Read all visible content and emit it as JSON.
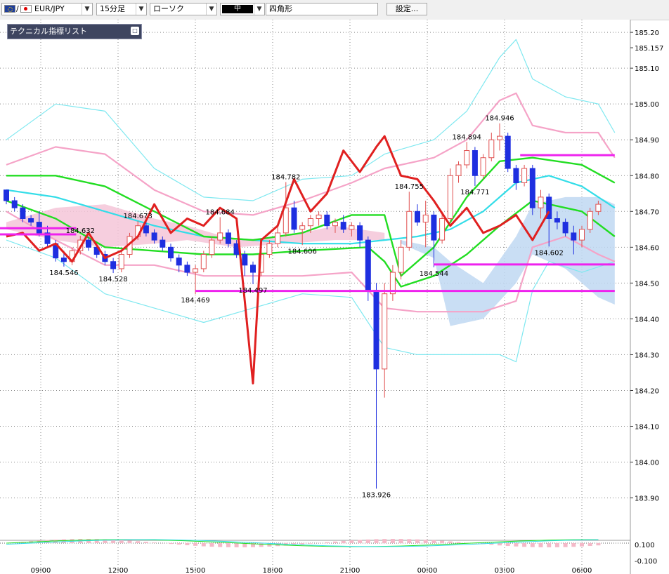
{
  "toolbar": {
    "symbol": "EUR/JPY",
    "symbol_sep": "/",
    "timeframe": "15分足",
    "chart_type": "ローソク",
    "color_label": "中",
    "shape": "四角形",
    "settings": "設定..."
  },
  "indicator_panel": {
    "label": "テクニカル指標リスト",
    "button": "□"
  },
  "icons": {
    "flag_eu": "eu-flag-icon",
    "flag_jp": "jp-flag-icon",
    "dropdown": "chevron-down-icon",
    "panel": "restore-icon"
  },
  "colors": {
    "bull_body": "#ffffff",
    "bull_line": "#e05050",
    "bear_body": "#1e2fe0",
    "bear_line": "#1e2fe0",
    "sma": "#22dd22",
    "mid": "#33dde8",
    "bb_outer": "#7ee8f0",
    "bb_inner": "#f5a3c7",
    "rsi": "#e02020",
    "level": "#ee22ee",
    "cloud_a": "#f5c6d8",
    "cloud_b": "#bfd8f2",
    "grid": "#888888"
  },
  "chart_data": {
    "type": "candlestick",
    "symbol": "EUR/JPY",
    "timeframe": "15分足",
    "ylim": [
      183.86,
      185.21
    ],
    "y_ticks": [
      "185.20",
      "185.157",
      "185.10",
      "185.00",
      "184.90",
      "184.80",
      "184.70",
      "184.60",
      "184.50",
      "184.40",
      "184.30",
      "184.20",
      "184.10",
      "184.00",
      "183.90"
    ],
    "x_ticks": [
      "09:00",
      "12:00",
      "15:00",
      "18:00",
      "21:00",
      "00:00",
      "03:00",
      "06:00"
    ],
    "oscillator_ticks": [
      "0.100",
      "-0.100"
    ],
    "candles": [
      [
        184.76,
        184.76,
        184.72,
        184.73
      ],
      [
        184.73,
        184.74,
        184.7,
        184.71
      ],
      [
        184.71,
        184.72,
        184.67,
        184.68
      ],
      [
        184.68,
        184.69,
        184.66,
        184.67
      ],
      [
        184.67,
        184.7,
        184.63,
        184.64
      ],
      [
        184.64,
        184.66,
        184.6,
        184.61
      ],
      [
        184.61,
        184.62,
        184.56,
        184.57
      ],
      [
        184.57,
        184.59,
        184.546,
        184.56
      ],
      [
        184.56,
        184.6,
        184.55,
        184.59
      ],
      [
        184.59,
        184.632,
        184.58,
        184.62
      ],
      [
        184.62,
        184.63,
        184.59,
        184.6
      ],
      [
        184.6,
        184.61,
        184.57,
        184.58
      ],
      [
        184.58,
        184.59,
        184.55,
        184.56
      ],
      [
        184.56,
        184.57,
        184.528,
        184.54
      ],
      [
        184.54,
        184.59,
        184.53,
        184.58
      ],
      [
        184.58,
        184.64,
        184.57,
        184.63
      ],
      [
        184.63,
        184.673,
        184.62,
        184.66
      ],
      [
        184.66,
        184.67,
        184.63,
        184.64
      ],
      [
        184.64,
        184.65,
        184.61,
        184.62
      ],
      [
        184.62,
        184.63,
        184.59,
        184.6
      ],
      [
        184.6,
        184.61,
        184.56,
        184.57
      ],
      [
        184.57,
        184.58,
        184.53,
        184.55
      ],
      [
        184.55,
        184.56,
        184.52,
        184.53
      ],
      [
        184.53,
        184.55,
        184.469,
        184.54
      ],
      [
        184.54,
        184.59,
        184.53,
        184.58
      ],
      [
        184.58,
        184.63,
        184.57,
        184.62
      ],
      [
        184.62,
        184.684,
        184.61,
        184.64
      ],
      [
        184.64,
        184.65,
        184.6,
        184.61
      ],
      [
        184.61,
        184.62,
        184.57,
        184.58
      ],
      [
        184.58,
        184.59,
        184.52,
        184.55
      ],
      [
        184.55,
        184.56,
        184.497,
        184.53
      ],
      [
        184.53,
        184.59,
        184.52,
        184.58
      ],
      [
        184.58,
        184.62,
        184.57,
        184.61
      ],
      [
        184.61,
        184.66,
        184.6,
        184.64
      ],
      [
        184.64,
        184.782,
        184.63,
        184.71
      ],
      [
        184.71,
        184.73,
        184.64,
        184.65
      ],
      [
        184.65,
        184.67,
        184.606,
        184.66
      ],
      [
        184.66,
        184.69,
        184.64,
        184.68
      ],
      [
        184.68,
        184.7,
        184.66,
        184.69
      ],
      [
        184.69,
        184.7,
        184.65,
        184.66
      ],
      [
        184.66,
        184.68,
        184.64,
        184.67
      ],
      [
        184.67,
        184.69,
        184.64,
        184.65
      ],
      [
        184.65,
        184.67,
        184.63,
        184.66
      ],
      [
        184.66,
        184.67,
        184.6,
        184.62
      ],
      [
        184.62,
        184.63,
        184.45,
        184.48
      ],
      [
        184.48,
        184.5,
        183.926,
        184.26
      ],
      [
        184.26,
        184.5,
        184.18,
        184.47
      ],
      [
        184.47,
        184.55,
        184.45,
        184.53
      ],
      [
        184.53,
        184.62,
        184.51,
        184.6
      ],
      [
        184.6,
        184.755,
        184.59,
        184.7
      ],
      [
        184.7,
        184.72,
        184.66,
        184.67
      ],
      [
        184.67,
        184.73,
        184.6,
        184.69
      ],
      [
        184.69,
        184.7,
        184.544,
        184.62
      ],
      [
        184.62,
        184.7,
        184.61,
        184.68
      ],
      [
        184.68,
        184.82,
        184.67,
        184.8
      ],
      [
        184.8,
        184.84,
        184.78,
        184.83
      ],
      [
        184.83,
        184.894,
        184.82,
        184.87
      ],
      [
        184.87,
        184.88,
        184.771,
        184.8
      ],
      [
        184.8,
        184.86,
        184.79,
        184.85
      ],
      [
        184.85,
        184.92,
        184.84,
        184.9
      ],
      [
        184.9,
        184.946,
        184.87,
        184.91
      ],
      [
        184.91,
        184.92,
        184.81,
        184.82
      ],
      [
        184.82,
        184.83,
        184.76,
        184.78
      ],
      [
        184.78,
        184.83,
        184.77,
        184.82
      ],
      [
        184.82,
        184.83,
        184.69,
        184.71
      ],
      [
        184.71,
        184.76,
        184.68,
        184.74
      ],
      [
        184.74,
        184.75,
        184.602,
        184.68
      ],
      [
        184.68,
        184.7,
        184.65,
        184.67
      ],
      [
        184.67,
        184.68,
        184.63,
        184.64
      ],
      [
        184.64,
        184.66,
        184.58,
        184.62
      ],
      [
        184.62,
        184.66,
        184.6,
        184.65
      ],
      [
        184.65,
        184.71,
        184.64,
        184.7
      ],
      [
        184.7,
        184.73,
        184.69,
        184.72
      ]
    ],
    "price_labels": [
      {
        "text": "184.546",
        "price": 184.546,
        "candle": 7,
        "pos": "below"
      },
      {
        "text": "184.632",
        "price": 184.632,
        "candle": 9,
        "pos": "above"
      },
      {
        "text": "184.528",
        "price": 184.528,
        "candle": 13,
        "pos": "below"
      },
      {
        "text": "184.673",
        "price": 184.673,
        "candle": 16,
        "pos": "above"
      },
      {
        "text": "184.469",
        "price": 184.469,
        "candle": 23,
        "pos": "below"
      },
      {
        "text": "184.684",
        "price": 184.684,
        "candle": 26,
        "pos": "above"
      },
      {
        "text": "184.497",
        "price": 184.497,
        "candle": 30,
        "pos": "below"
      },
      {
        "text": "184.782",
        "price": 184.782,
        "candle": 34,
        "pos": "above"
      },
      {
        "text": "184.606",
        "price": 184.606,
        "candle": 36,
        "pos": "below"
      },
      {
        "text": "183.926",
        "price": 183.926,
        "candle": 45,
        "pos": "below"
      },
      {
        "text": "184.755",
        "price": 184.755,
        "candle": 49,
        "pos": "above"
      },
      {
        "text": "184.544",
        "price": 184.544,
        "candle": 52,
        "pos": "below"
      },
      {
        "text": "184.894",
        "price": 184.894,
        "candle": 56,
        "pos": "above"
      },
      {
        "text": "184.771",
        "price": 184.771,
        "candle": 57,
        "pos": "below"
      },
      {
        "text": "184.946",
        "price": 184.946,
        "candle": 60,
        "pos": "above"
      },
      {
        "text": "184.602",
        "price": 184.602,
        "candle": 66,
        "pos": "below"
      }
    ],
    "levels": [
      {
        "price": 184.653,
        "from_candle": -1,
        "to_candle": 8.5
      },
      {
        "price": 184.636,
        "from_candle": -1,
        "to_candle": 8.5
      },
      {
        "price": 184.857,
        "from_candle": 62.5,
        "to_candle": 74
      },
      {
        "price": 184.552,
        "from_candle": 52,
        "to_candle": 74
      },
      {
        "price": 184.478,
        "from_candle": 23,
        "to_candle": 74
      }
    ],
    "indicators": {
      "sma": [
        [
          0,
          184.8
        ],
        [
          6,
          184.8
        ],
        [
          12,
          184.77
        ],
        [
          18,
          184.7
        ],
        [
          24,
          184.63
        ],
        [
          30,
          184.62
        ],
        [
          36,
          184.64
        ],
        [
          42,
          184.69
        ],
        [
          46,
          184.69
        ],
        [
          48,
          184.52
        ],
        [
          52,
          184.6
        ],
        [
          56,
          184.74
        ],
        [
          60,
          184.84
        ],
        [
          64,
          184.85
        ],
        [
          70,
          184.83
        ],
        [
          74,
          184.78
        ]
      ],
      "sma2": [
        [
          0,
          184.73
        ],
        [
          6,
          184.68
        ],
        [
          12,
          184.6
        ],
        [
          18,
          184.59
        ],
        [
          24,
          184.58
        ],
        [
          30,
          184.58
        ],
        [
          36,
          184.59
        ],
        [
          44,
          184.6
        ],
        [
          46,
          184.56
        ],
        [
          48,
          184.49
        ],
        [
          52,
          184.52
        ],
        [
          56,
          184.58
        ],
        [
          60,
          184.66
        ],
        [
          64,
          184.73
        ],
        [
          70,
          184.7
        ],
        [
          74,
          184.63
        ]
      ],
      "mid": [
        [
          0,
          184.76
        ],
        [
          6,
          184.74
        ],
        [
          12,
          184.7
        ],
        [
          18,
          184.66
        ],
        [
          24,
          184.63
        ],
        [
          30,
          184.62
        ],
        [
          36,
          184.61
        ],
        [
          42,
          184.61
        ],
        [
          46,
          184.62
        ],
        [
          50,
          184.63
        ],
        [
          54,
          184.65
        ],
        [
          58,
          184.7
        ],
        [
          62,
          184.78
        ],
        [
          66,
          184.8
        ],
        [
          70,
          184.77
        ],
        [
          74,
          184.71
        ]
      ],
      "bb_upper_outer": [
        [
          0,
          184.9
        ],
        [
          6,
          185.0
        ],
        [
          12,
          184.98
        ],
        [
          18,
          184.82
        ],
        [
          24,
          184.74
        ],
        [
          30,
          184.73
        ],
        [
          36,
          184.79
        ],
        [
          42,
          184.8
        ],
        [
          46,
          184.86
        ],
        [
          52,
          184.9
        ],
        [
          56,
          184.98
        ],
        [
          60,
          185.13
        ],
        [
          62,
          185.18
        ],
        [
          64,
          185.07
        ],
        [
          68,
          185.02
        ],
        [
          72,
          185.0
        ],
        [
          74,
          184.92
        ]
      ],
      "bb_upper_inner": [
        [
          0,
          184.83
        ],
        [
          6,
          184.88
        ],
        [
          12,
          184.86
        ],
        [
          18,
          184.76
        ],
        [
          24,
          184.7
        ],
        [
          30,
          184.69
        ],
        [
          36,
          184.73
        ],
        [
          42,
          184.78
        ],
        [
          46,
          184.82
        ],
        [
          52,
          184.85
        ],
        [
          56,
          184.9
        ],
        [
          60,
          185.01
        ],
        [
          62,
          185.03
        ],
        [
          64,
          184.94
        ],
        [
          68,
          184.92
        ],
        [
          72,
          184.92
        ],
        [
          74,
          184.85
        ]
      ],
      "bb_lower_inner": [
        [
          0,
          184.7
        ],
        [
          6,
          184.62
        ],
        [
          12,
          184.55
        ],
        [
          18,
          184.55
        ],
        [
          24,
          184.52
        ],
        [
          30,
          184.52
        ],
        [
          36,
          184.52
        ],
        [
          42,
          184.53
        ],
        [
          46,
          184.43
        ],
        [
          50,
          184.42
        ],
        [
          54,
          184.42
        ],
        [
          58,
          184.42
        ],
        [
          62,
          184.45
        ],
        [
          64,
          184.6
        ],
        [
          68,
          184.63
        ],
        [
          72,
          184.58
        ],
        [
          74,
          184.56
        ]
      ],
      "bb_lower_outer": [
        [
          0,
          184.62
        ],
        [
          6,
          184.57
        ],
        [
          12,
          184.47
        ],
        [
          18,
          184.43
        ],
        [
          24,
          184.39
        ],
        [
          30,
          184.43
        ],
        [
          36,
          184.47
        ],
        [
          42,
          184.46
        ],
        [
          46,
          184.32
        ],
        [
          50,
          184.3
        ],
        [
          56,
          184.3
        ],
        [
          60,
          184.3
        ],
        [
          62,
          184.28
        ],
        [
          64,
          184.48
        ],
        [
          66,
          184.56
        ],
        [
          70,
          184.53
        ],
        [
          74,
          184.56
        ]
      ],
      "rsi": [
        [
          0,
          184.63
        ],
        [
          2,
          184.64
        ],
        [
          4,
          184.59
        ],
        [
          6,
          184.61
        ],
        [
          8,
          184.56
        ],
        [
          10,
          184.64
        ],
        [
          12,
          184.57
        ],
        [
          14,
          184.59
        ],
        [
          16,
          184.63
        ],
        [
          18,
          184.72
        ],
        [
          20,
          184.64
        ],
        [
          22,
          184.68
        ],
        [
          24,
          184.66
        ],
        [
          26,
          184.71
        ],
        [
          28,
          184.68
        ],
        [
          30,
          184.22
        ],
        [
          31,
          184.62
        ],
        [
          33,
          184.66
        ],
        [
          35,
          184.79
        ],
        [
          37,
          184.7
        ],
        [
          39,
          184.75
        ],
        [
          41,
          184.87
        ],
        [
          43,
          184.81
        ],
        [
          45,
          184.88
        ],
        [
          46,
          184.91
        ],
        [
          48,
          184.8
        ],
        [
          50,
          184.79
        ],
        [
          52,
          184.73
        ],
        [
          54,
          184.66
        ],
        [
          56,
          184.71
        ],
        [
          58,
          184.64
        ],
        [
          60,
          184.66
        ],
        [
          62,
          184.69
        ],
        [
          64,
          184.62
        ],
        [
          66,
          184.7
        ]
      ]
    },
    "clouds": {
      "pink": [
        [
          0,
          184.67,
          184.65
        ],
        [
          6,
          184.71,
          184.62
        ],
        [
          12,
          184.72,
          184.6
        ],
        [
          18,
          184.68,
          184.61
        ],
        [
          22,
          184.66,
          184.62
        ],
        [
          28,
          184.62,
          184.6
        ],
        [
          34,
          184.63,
          184.61
        ],
        [
          40,
          184.66,
          184.62
        ],
        [
          46,
          184.64,
          184.62
        ]
      ],
      "blue": [
        [
          48,
          184.62,
          184.61
        ],
        [
          52,
          184.6,
          184.57
        ],
        [
          54,
          184.56,
          184.38
        ],
        [
          58,
          184.5,
          184.4
        ],
        [
          62,
          184.63,
          184.5
        ],
        [
          64,
          184.72,
          184.58
        ],
        [
          68,
          184.74,
          184.54
        ],
        [
          72,
          184.74,
          184.46
        ],
        [
          74,
          184.72,
          184.44
        ]
      ]
    }
  }
}
